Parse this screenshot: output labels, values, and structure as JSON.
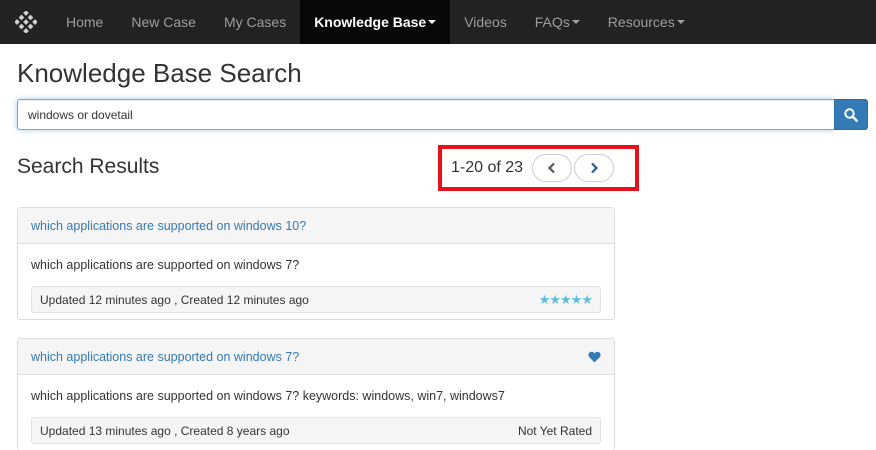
{
  "nav": {
    "items": [
      {
        "label": "Home",
        "active": false,
        "dropdown": false
      },
      {
        "label": "New Case",
        "active": false,
        "dropdown": false
      },
      {
        "label": "My Cases",
        "active": false,
        "dropdown": false
      },
      {
        "label": "Knowledge Base",
        "active": true,
        "dropdown": true
      },
      {
        "label": "Videos",
        "active": false,
        "dropdown": false
      },
      {
        "label": "FAQs",
        "active": false,
        "dropdown": true
      },
      {
        "label": "Resources",
        "active": false,
        "dropdown": true
      }
    ]
  },
  "page": {
    "title": "Knowledge Base Search"
  },
  "search": {
    "value": "windows or dovetail"
  },
  "results": {
    "title": "Search Results",
    "pager": {
      "range_text": "1-20 of 23"
    },
    "items": [
      {
        "title": "which applications are supported on windows 10?",
        "summary": "which applications are supported on windows 7?",
        "meta": "Updated 12 minutes ago , Created 12 minutes ago",
        "rating_stars": 5,
        "rating_text": "★★★★★",
        "favorited": false
      },
      {
        "title": "which applications are supported on windows 7?",
        "summary": "which applications are supported on windows 7? keywords: windows, win7, windows7",
        "meta": "Updated 13 minutes ago , Created 8 years ago",
        "rating_text": "Not Yet Rated",
        "favorited": true
      }
    ]
  },
  "colors": {
    "navbar_bg": "#222222",
    "link": "#337ab7",
    "highlight_border": "#e8101c",
    "star": "#5bc0de"
  }
}
